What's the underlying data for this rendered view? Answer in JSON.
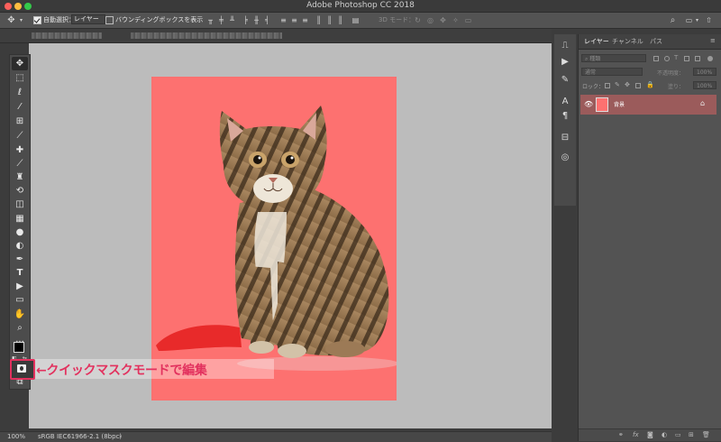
{
  "window": {
    "title": "Adobe Photoshop CC 2018"
  },
  "options_bar": {
    "auto_select_label": "自動選択：",
    "auto_select_value": "レイヤー",
    "bounding_box_label": "バウンディングボックスを表示",
    "mode_3d_label": "3D モード："
  },
  "layers_panel": {
    "tabs": [
      "レイヤー",
      "チャンネル",
      "パス"
    ],
    "search_placeholder": "種類",
    "blend_mode": "通常",
    "opacity_label": "不透明度：",
    "opacity_value": "100%",
    "lock_label": "ロック：",
    "fill_label": "塗り：",
    "fill_value": "100%",
    "layer": {
      "name": "背景"
    }
  },
  "annotation": {
    "text": "←クイックマスクモードで編集"
  },
  "status": {
    "zoom": "100%",
    "profile": "sRGB IEC61966-2.1 (8bpc)",
    "arrow": "›"
  },
  "colors": {
    "quick_mask": "#fd7170",
    "annotation": "#e2315e",
    "canvas_bg": "#bcbcbc",
    "selected_layer": "#9b5b5b"
  },
  "toolbar": {
    "tool_icons": [
      "move-icon",
      "marquee-icon",
      "lasso-icon",
      "magic-wand-icon",
      "crop-icon",
      "eyedropper-icon",
      "healing-brush-icon",
      "brush-icon",
      "stamp-icon",
      "history-brush-icon",
      "eraser-icon",
      "gradient-icon",
      "blur-icon",
      "dodge-icon",
      "pen-icon",
      "type-icon",
      "path-select-icon",
      "shape-icon",
      "hand-icon",
      "zoom-icon",
      "more-tools-icon"
    ],
    "type_glyph": "T"
  }
}
